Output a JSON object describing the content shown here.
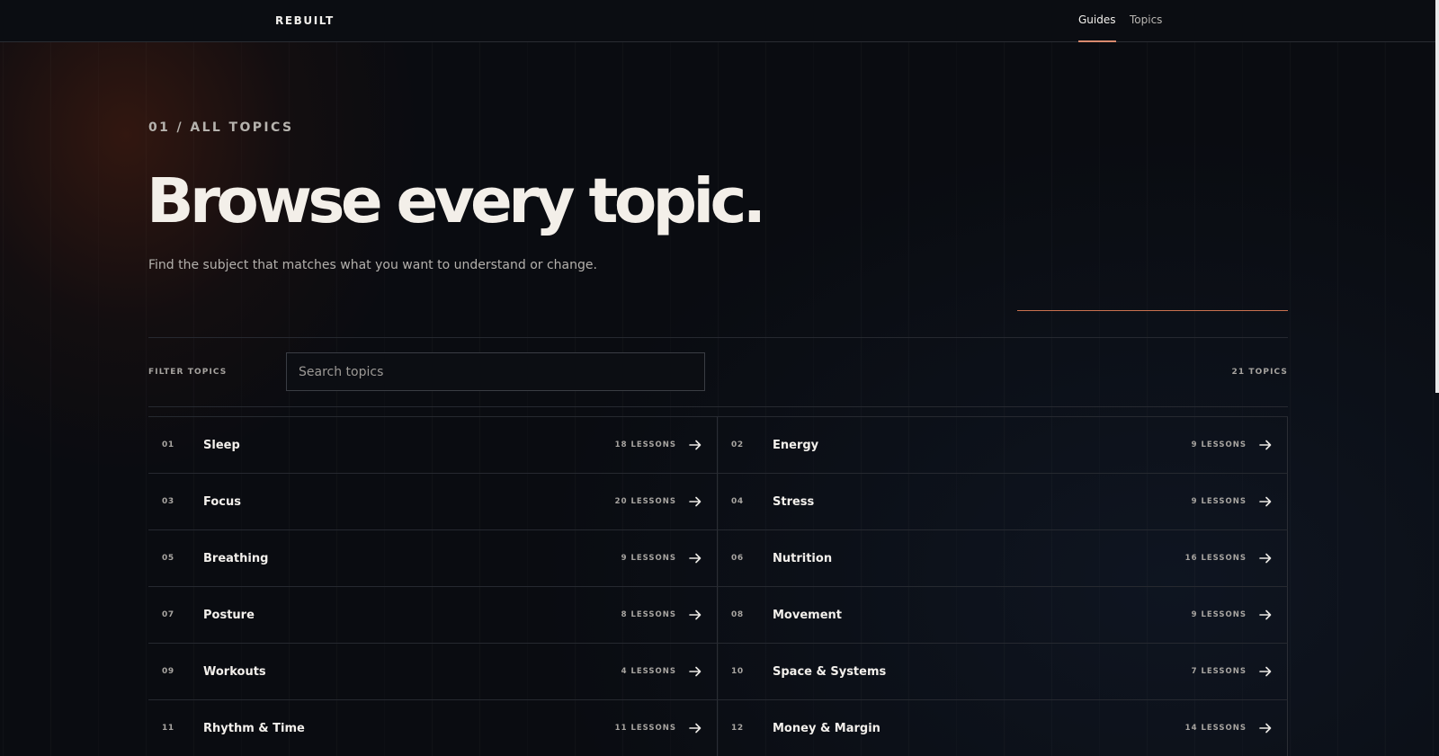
{
  "header": {
    "brand": "REBUILT",
    "nav": [
      {
        "label": "Guides",
        "active": true
      },
      {
        "label": "Topics",
        "active": false
      }
    ]
  },
  "hero": {
    "eyebrow": "01 / ALL TOPICS",
    "title": "Browse every topic.",
    "subtitle": "Find the subject that matches what you want to understand or change."
  },
  "filter": {
    "label": "FILTER TOPICS",
    "search_placeholder": "Search topics",
    "count_label": "21 TOPICS"
  },
  "topics": [
    {
      "number": "01",
      "name": "Sleep",
      "lessons": "18 LESSONS"
    },
    {
      "number": "02",
      "name": "Energy",
      "lessons": "9 LESSONS"
    },
    {
      "number": "03",
      "name": "Focus",
      "lessons": "20 LESSONS"
    },
    {
      "number": "04",
      "name": "Stress",
      "lessons": "9 LESSONS"
    },
    {
      "number": "05",
      "name": "Breathing",
      "lessons": "9 LESSONS"
    },
    {
      "number": "06",
      "name": "Nutrition",
      "lessons": "16 LESSONS"
    },
    {
      "number": "07",
      "name": "Posture",
      "lessons": "8 LESSONS"
    },
    {
      "number": "08",
      "name": "Movement",
      "lessons": "9 LESSONS"
    },
    {
      "number": "09",
      "name": "Workouts",
      "lessons": "4 LESSONS"
    },
    {
      "number": "10",
      "name": "Space & Systems",
      "lessons": "7 LESSONS"
    },
    {
      "number": "11",
      "name": "Rhythm & Time",
      "lessons": "11 LESSONS"
    },
    {
      "number": "12",
      "name": "Money & Margin",
      "lessons": "14 LESSONS"
    }
  ],
  "icons": {
    "row_action": "arrow-right-icon"
  },
  "colors": {
    "background": "#0a0c11",
    "accent": "#d98a6e",
    "text_primary": "#f3efe9",
    "text_muted": "#a8a5a1"
  }
}
